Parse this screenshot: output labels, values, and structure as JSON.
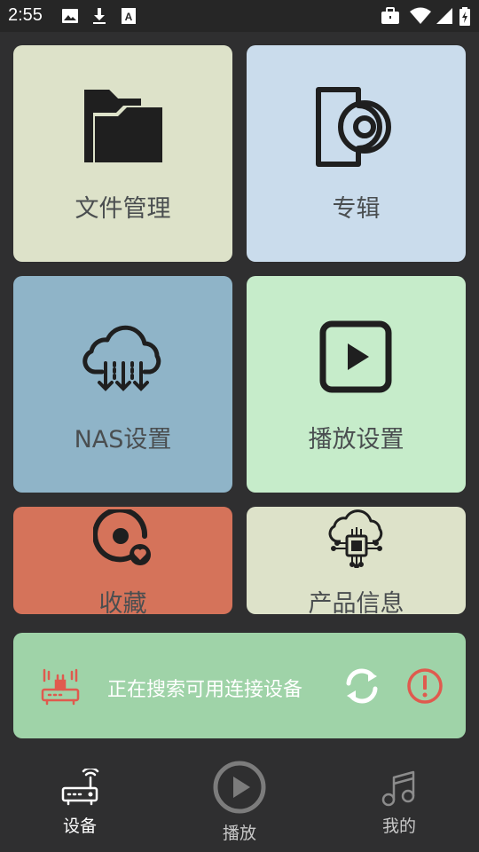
{
  "status_bar": {
    "time": "2:55",
    "left_icons": [
      "image-icon",
      "download-icon",
      "font-a-icon"
    ],
    "right_icons": [
      "briefcase-icon",
      "wifi-icon",
      "signal-icon",
      "battery-charging-icon"
    ]
  },
  "tiles": [
    {
      "label": "文件管理",
      "icon": "folder-icon",
      "color": "#dde2c9"
    },
    {
      "label": "专辑",
      "icon": "album-disc-icon",
      "color": "#cadcec"
    },
    {
      "label": "NAS设置",
      "icon": "cloud-download-icon",
      "color": "#8fb4c8"
    },
    {
      "label": "播放设置",
      "icon": "play-square-icon",
      "color": "#c6ecca"
    },
    {
      "label": "收藏",
      "icon": "favorite-disc-icon",
      "color": "#d5735a"
    },
    {
      "label": "产品信息",
      "icon": "cloud-chip-icon",
      "color": "#dde2c9"
    }
  ],
  "banner": {
    "status_text": "正在搜索可用连接设备",
    "left_icon": "router-device-icon",
    "refresh_icon": "refresh-icon",
    "alert_icon": "alert-circle-icon",
    "color": "#9fd3a8"
  },
  "bottom_nav": [
    {
      "label": "设备",
      "icon": "router-icon",
      "active": true
    },
    {
      "label": "播放",
      "icon": "play-circle-icon",
      "active": false
    },
    {
      "label": "我的",
      "icon": "music-note-icon",
      "active": false
    }
  ]
}
